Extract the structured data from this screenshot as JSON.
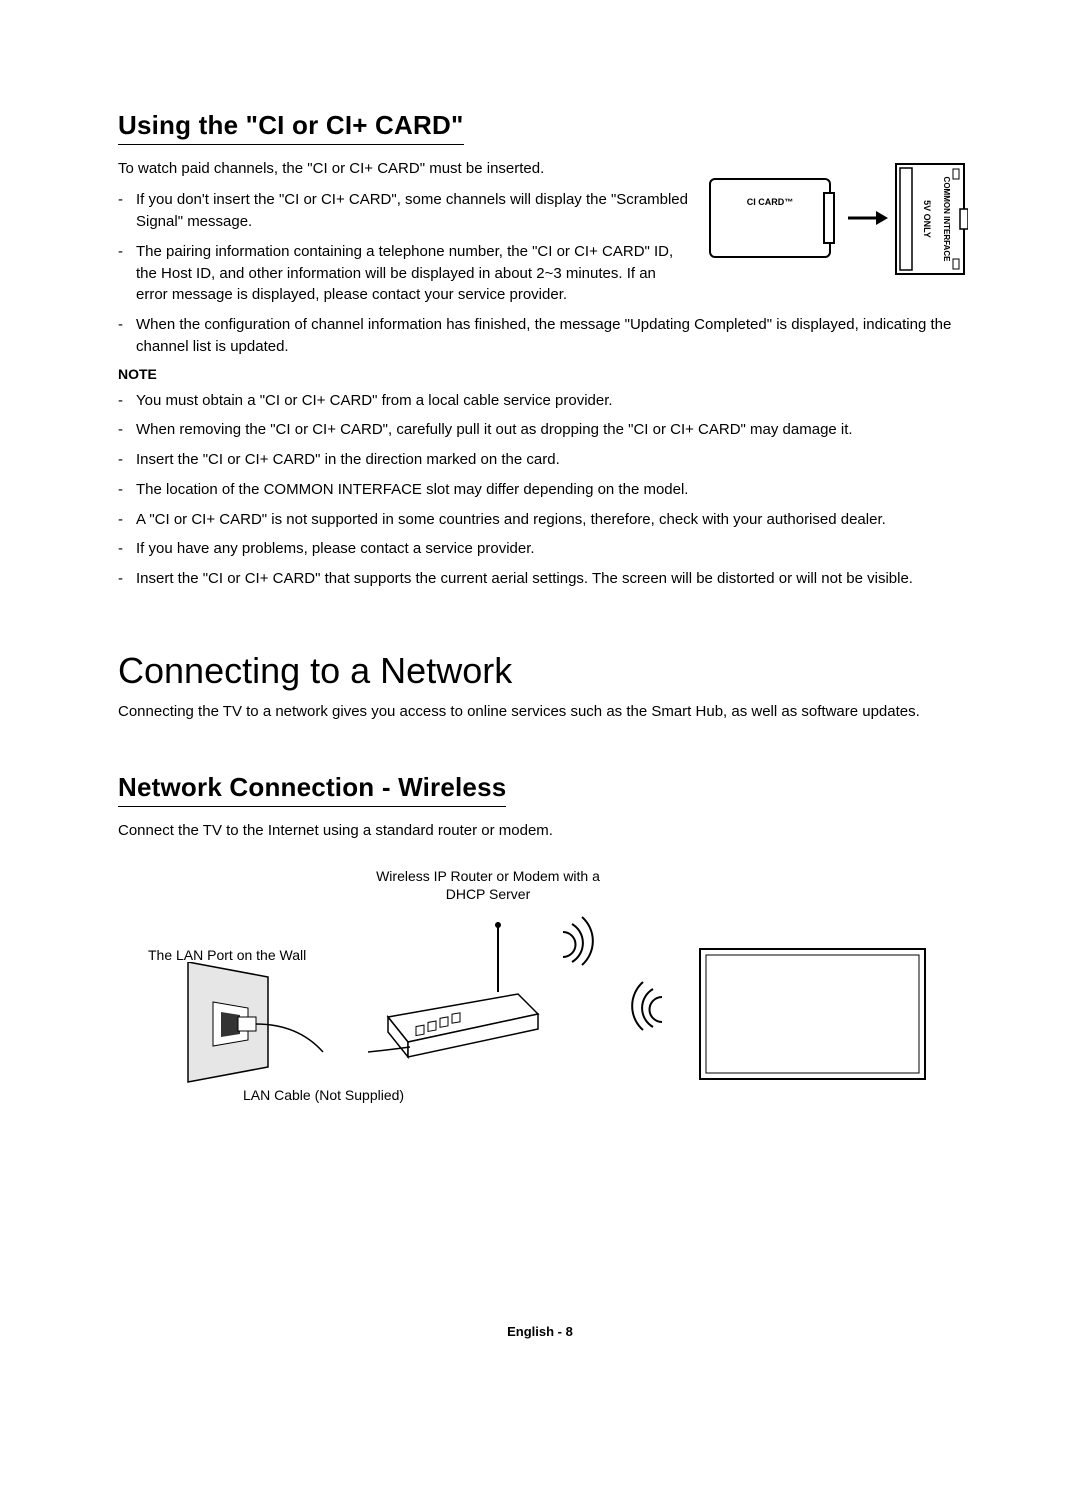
{
  "ci_section": {
    "title": "Using the \"CI or CI+ CARD\"",
    "intro": "To watch paid channels, the \"CI or CI+ CARD\" must be inserted.",
    "bullets_top": [
      "If you don't insert the \"CI or CI+ CARD\", some channels will display the \"Scrambled Signal\" message.",
      "The pairing information containing a telephone number, the \"CI or CI+ CARD\" ID, the Host ID, and other information will be displayed in about 2~3 minutes. If an error message is displayed, please contact your service provider."
    ],
    "bullets_full": [
      "When the configuration of channel information has finished, the message \"Updating Completed\" is displayed, indicating the channel list is updated."
    ],
    "note_heading": "NOTE",
    "notes": [
      "You must obtain a \"CI or CI+ CARD\" from a local cable service provider.",
      "When removing the \"CI or CI+ CARD\", carefully pull it out as dropping the \"CI or CI+ CARD\" may damage it.",
      "Insert the \"CI or CI+ CARD\" in the direction marked on the card.",
      "The location of the COMMON INTERFACE slot may differ depending on the model.",
      "A \"CI or CI+ CARD\" is not supported in some countries and regions, therefore, check with your authorised dealer.",
      "If you have any problems, please contact a service provider.",
      "Insert the \"CI or CI+ CARD\" that supports the current aerial settings. The screen will be distorted or will not be visible."
    ],
    "card_label": "CI CARD™",
    "slot_label_1": "5V ONLY",
    "slot_label_2": "COMMON INTERFACE"
  },
  "network_section": {
    "title": "Connecting to a Network",
    "intro": "Connecting the TV to a network gives you access to online services such as the Smart Hub, as well as software updates."
  },
  "wireless_section": {
    "title": "Network Connection - Wireless",
    "intro": "Connect the TV to the Internet using a standard router or modem.",
    "router_caption": "Wireless IP Router or Modem with a DHCP Server",
    "lan_port_label": "The LAN Port on the Wall",
    "lan_cable_label": "LAN Cable (Not Supplied)"
  },
  "footer": "English - 8"
}
